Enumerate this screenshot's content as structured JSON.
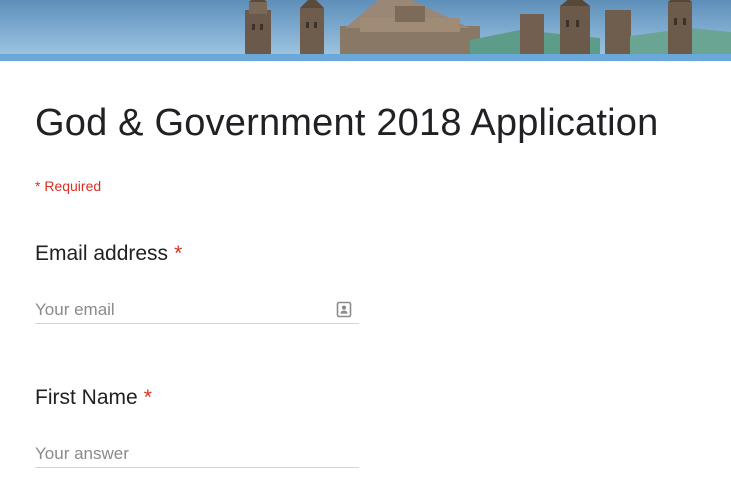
{
  "form": {
    "title": "God & Government 2018 Application",
    "required_note": "* Required",
    "theme_colors": {
      "accent_bar": "#6aa8d9",
      "required": "#d93025",
      "text": "#202124"
    }
  },
  "questions": [
    {
      "label": "Email address",
      "required_mark": "*",
      "value": "",
      "placeholder": "Your email",
      "icon": "contact-card-icon"
    },
    {
      "label": "First Name",
      "required_mark": "*",
      "value": "",
      "placeholder": "Your answer"
    }
  ]
}
